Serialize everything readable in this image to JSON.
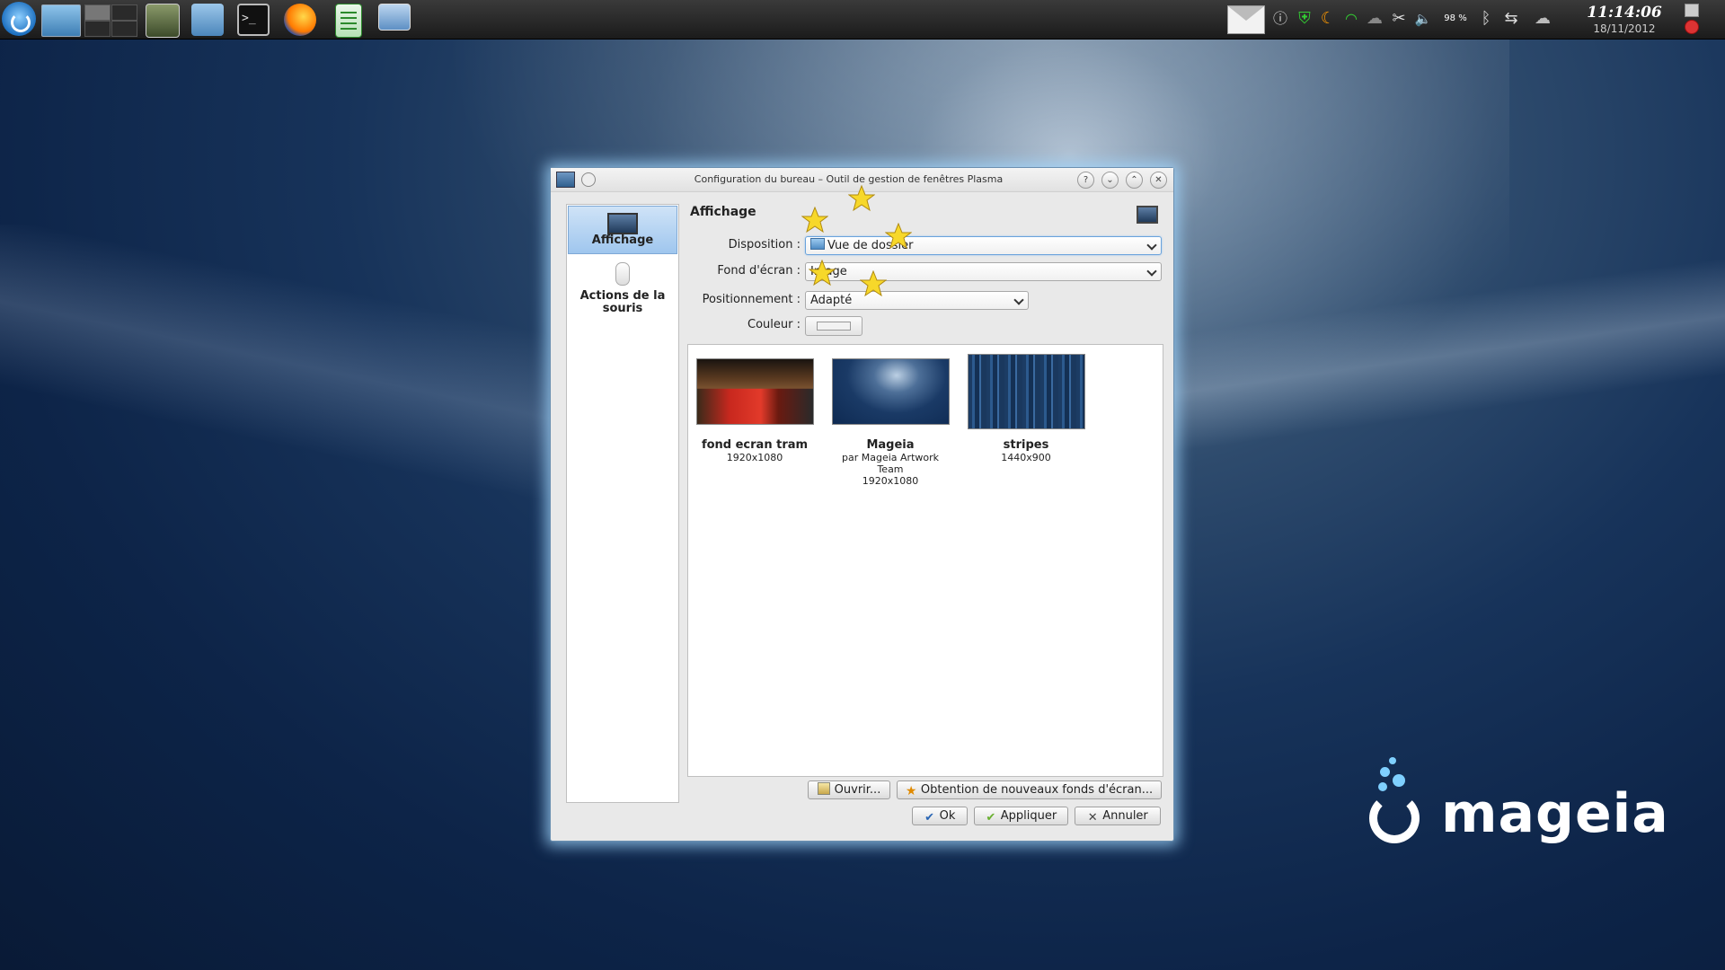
{
  "panel": {
    "clock_time": "11:14:06",
    "clock_date": "18/11/2012",
    "battery": "98 %",
    "icons": [
      "mageia-launcher-icon",
      "desktop-preview-icon",
      "pager-icon",
      "system-settings-icon",
      "home-folder-icon",
      "terminal-icon",
      "firefox-icon",
      "spreadsheet-icon",
      "display-settings-icon",
      "mail-icon",
      "info-icon",
      "update-shield-icon",
      "weather-icon",
      "wifi-icon",
      "network-icon",
      "klipper-icon",
      "volume-icon",
      "battery-icon",
      "bluetooth-icon",
      "usb-icon",
      "cloud-icon",
      "lock-icon",
      "power-icon"
    ],
    "terminal_glyph": ">_"
  },
  "window": {
    "title": "Configuration du bureau – Outil de gestion de fenêtres Plasma",
    "buttons": {
      "help": "?",
      "minimize": "⌄",
      "maximize": "⌃",
      "close": "✕"
    },
    "sidebar": [
      {
        "label": "Affichage",
        "icon": "monitor-icon",
        "selected": true
      },
      {
        "label": "Actions de la souris",
        "icon": "mouse-icon",
        "selected": false
      }
    ],
    "section_title": "Affichage",
    "form": {
      "disposition_label": "Disposition :",
      "disposition_value": "Vue de dossier",
      "fond_label": "Fond d'écran :",
      "fond_value": "Image",
      "position_label": "Positionnement :",
      "position_value": "Adapté",
      "couleur_label": "Couleur :"
    },
    "wallpapers": [
      {
        "name": "fond ecran tram",
        "author": "",
        "size": "1920x1080"
      },
      {
        "name": "Mageia",
        "author": "par Mageia Artwork Team",
        "size": "1920x1080"
      },
      {
        "name": "stripes",
        "author": "",
        "size": "1440x900"
      }
    ],
    "buttons_bottom": {
      "open": "Ouvrir...",
      "get_new": "Obtention de nouveaux fonds d'écran...",
      "ok": "Ok",
      "apply": "Appliquer",
      "cancel": "Annuler"
    }
  },
  "desktop": {
    "brand": "mageia"
  },
  "colors": {
    "accent": "#7ea9d6",
    "window_glow": "#a0d7ff",
    "star": "#f7d82a"
  }
}
